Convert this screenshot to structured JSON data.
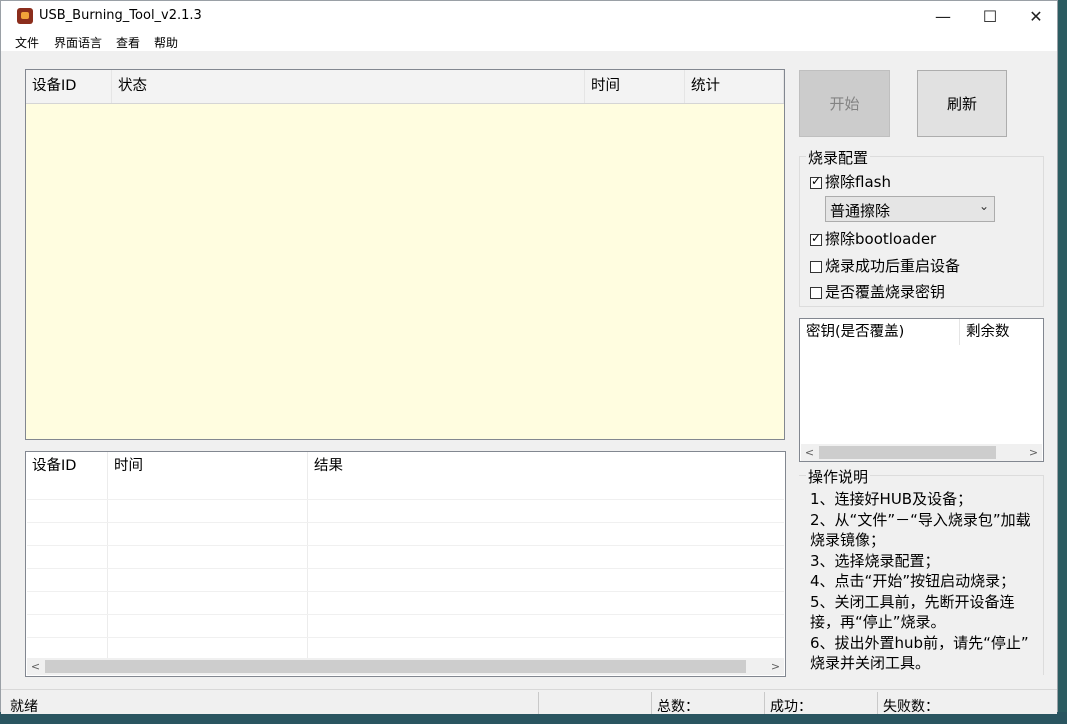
{
  "window": {
    "title": "USB_Burning_Tool_v2.1.3",
    "minimize": "—",
    "maximize": "☐",
    "close": "✕"
  },
  "menu": [
    "文件",
    "界面语言",
    "查看",
    "帮助"
  ],
  "device_table": {
    "columns": [
      "设备ID",
      "状态",
      "时间",
      "统计"
    ],
    "rows": []
  },
  "result_table": {
    "columns": [
      "设备ID",
      "时间",
      "结果"
    ],
    "rows": []
  },
  "buttons": {
    "start": "开始",
    "refresh": "刷新"
  },
  "burn_config": {
    "title": "烧录配置",
    "erase_flash": {
      "label": "擦除flash",
      "checked": true
    },
    "erase_mode": {
      "value": "普通擦除",
      "options": [
        "普通擦除"
      ]
    },
    "erase_bootloader": {
      "label": "擦除bootloader",
      "checked": true
    },
    "reboot_after": {
      "label": "烧录成功后重启设备",
      "checked": false
    },
    "overwrite_key": {
      "label": "是否覆盖烧录密钥",
      "checked": false
    }
  },
  "key_table": {
    "columns": [
      "密钥(是否覆盖)",
      "剩余数"
    ],
    "rows": []
  },
  "instructions": {
    "title": "操作说明",
    "lines": [
      "1、连接好HUB及设备；",
      "2、从“文件”－“导入烧录包”加载",
      "烧录镜像；",
      "3、选择烧录配置；",
      "4、点击“开始”按钮启动烧录；",
      "5、关闭工具前，先断开设备连",
      "接，再“停止”烧录。",
      "6、拔出外置hub前，请先“停止”",
      "烧录并关闭工具。"
    ]
  },
  "statusbar": {
    "status": "就绪",
    "total": "总数：",
    "success": "成功：",
    "fail": "失败数："
  },
  "colors": {
    "device_list_bg": "#fffde0",
    "window_bg": "#f0f0f0"
  }
}
